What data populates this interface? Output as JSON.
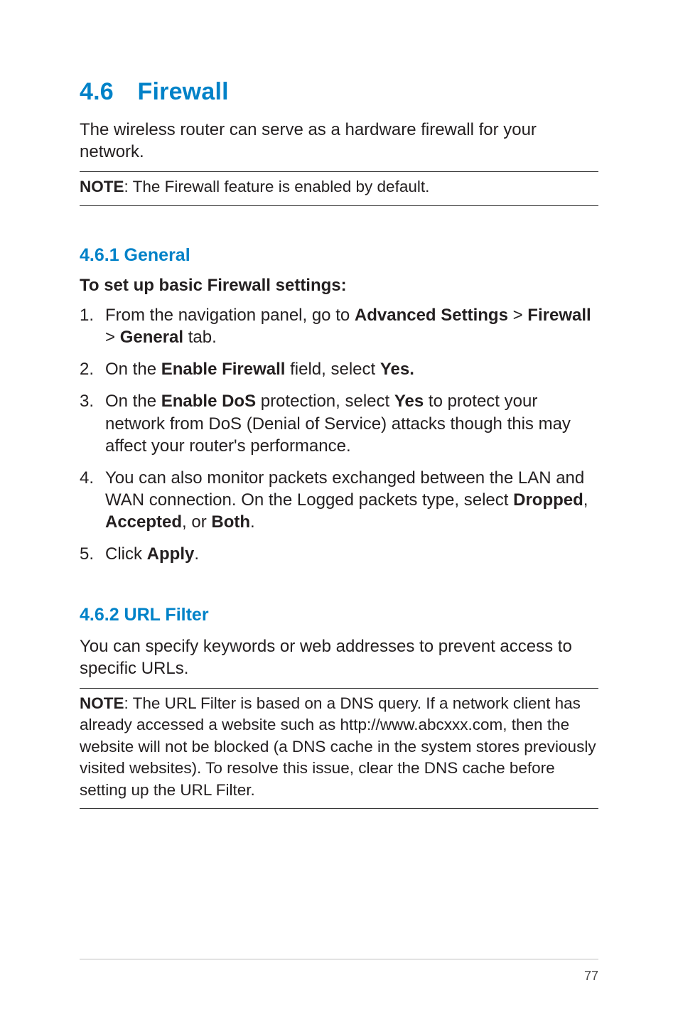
{
  "section": {
    "number": "4.6",
    "title": "Firewall",
    "intro": "The wireless router can serve as a hardware firewall for your network."
  },
  "note1": {
    "label": "NOTE",
    "text": ":  The Firewall feature is enabled by default."
  },
  "general": {
    "heading": "4.6.1 General",
    "instr_title": "To set up basic Firewall settings:",
    "steps": [
      {
        "marker": "1.",
        "prefix": "From the navigation panel, go to ",
        "b1": "Advanced Settings",
        "sep1": " > ",
        "b2": "Firewall",
        "sep2": " > ",
        "b3": "General",
        "suffix": " tab."
      },
      {
        "marker": "2.",
        "prefix": "On the ",
        "b1": "Enable Firewall",
        "mid": " field, select ",
        "b2": "Yes."
      },
      {
        "marker": "3.",
        "prefix": "On the ",
        "b1": "Enable DoS",
        "mid": " protection, select ",
        "b2": "Yes",
        "suffix": " to protect your network from DoS (Denial of Service) attacks though this may affect your router's performance."
      },
      {
        "marker": "4.",
        "prefix": "You can also monitor packets exchanged between the LAN and WAN connection. On the Logged packets type, select ",
        "b1": "Dropped",
        "sep1": ", ",
        "b2": "Accepted",
        "sep2": ", or ",
        "b3": "Both",
        "suffix": "."
      },
      {
        "marker": "5.",
        "prefix": "Click ",
        "b1": "Apply",
        "suffix": "."
      }
    ]
  },
  "urlfilter": {
    "heading": "4.6.2 URL Filter",
    "intro": "You can specify keywords or web addresses to prevent access to specific URLs."
  },
  "note2": {
    "label": "NOTE",
    "text": ":  The URL Filter is based on a DNS query. If a network client has already accessed a website such as http://www.abcxxx.com, then the website will not be blocked (a DNS cache in the system stores previously visited websites). To resolve this issue, clear the DNS cache before setting up the URL Filter."
  },
  "page_number": "77"
}
